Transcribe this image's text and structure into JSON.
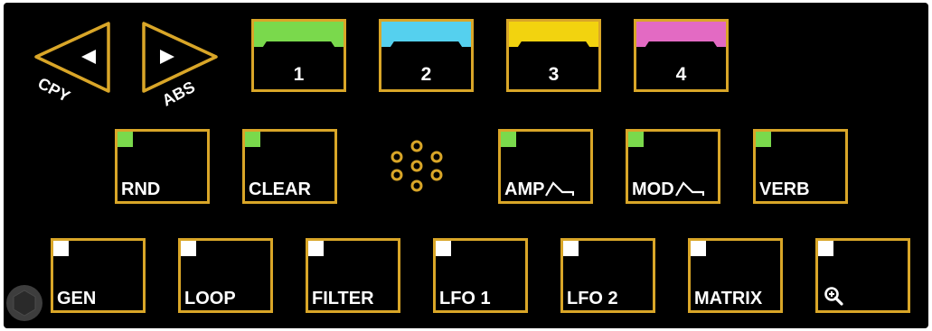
{
  "colors": {
    "background": "#000000",
    "outline": "#d9a628",
    "lamp_green": "#7ad94c",
    "lamp_white": "#ffffff"
  },
  "nav": {
    "left_label": "CPY",
    "right_label": "ABS"
  },
  "patterns": [
    {
      "label": "1",
      "color": "#7ad94c"
    },
    {
      "label": "2",
      "color": "#55d0ee"
    },
    {
      "label": "3",
      "color": "#f2d30f"
    },
    {
      "label": "4",
      "color": "#e36ac3"
    }
  ],
  "row2": {
    "rnd": "RND",
    "clear": "CLEAR",
    "amp": "AMP",
    "mod": "MOD",
    "verb": "VERB",
    "lamp_color": "#7ad94c"
  },
  "row3": {
    "gen": "GEN",
    "loop": "LOOP",
    "filter": "FILTER",
    "lfo1": "LFO 1",
    "lfo2": "LFO 2",
    "matrix": "MATRIX",
    "zoom_icon": "zoom-in-icon",
    "lamp_color": "#ffffff"
  }
}
